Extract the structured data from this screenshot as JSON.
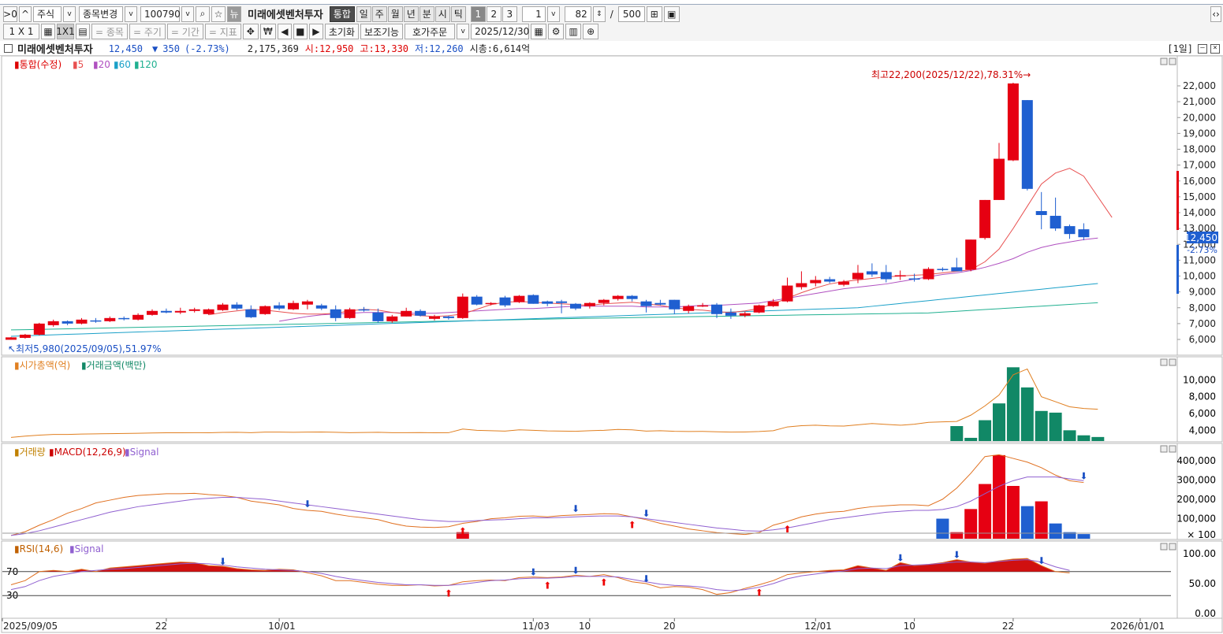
{
  "toolbar1": {
    "market": "주식",
    "change_label": "종목변경",
    "code": "100790",
    "news": "뉴",
    "stock_name": "미래에셋벤처투자",
    "combine": "통합",
    "periods": [
      "일",
      "주",
      "월",
      "년",
      "분",
      "시",
      "틱"
    ],
    "pages": [
      "1",
      "2",
      "3"
    ],
    "unit": "1",
    "count": "82",
    "slash": "/",
    "total": "500"
  },
  "toolbar2": {
    "layouts": [
      "1 X 1",
      "1X1"
    ],
    "grey": [
      "= 종목",
      "= 주기",
      "= 기간",
      "= 지표"
    ],
    "reset": "초기화",
    "aux": "보조기능",
    "order": "호가주문",
    "date": "2025/12/30"
  },
  "info": {
    "name": "미래에셋벤처투자",
    "price": "12,450",
    "change_arrow": "▼",
    "change": "350",
    "change_pct": "(-2.73%)",
    "volume": "2,175,369",
    "open": "시:12,950",
    "high": "고:13,330",
    "low": "저:12,260",
    "mktcap": "시총:6,614억",
    "period_tag": "[1일]"
  },
  "colors": {
    "up": "#e60012",
    "down": "#1f5fd0",
    "ma5": "#e85050",
    "ma20": "#b050c0",
    "ma60": "#1aa0c8",
    "ma120": "#20b090",
    "mktcap": "#e07f20",
    "amount": "#118866",
    "macd": "#e07020",
    "signal": "#9060d0"
  },
  "chart_data": [
    {
      "type": "candlestick",
      "title": "통합(수정)",
      "legend": [
        "5",
        "20",
        "60",
        "120"
      ],
      "ylim": [
        5000,
        23000
      ],
      "yticks": [
        "22,000",
        "21,000",
        "20,000",
        "19,000",
        "18,000",
        "17,000",
        "16,000",
        "15,000",
        "14,000",
        "13,000",
        "12,000",
        "11,000",
        "10,000",
        "9,000",
        "8,000",
        "7,000",
        "6,000"
      ],
      "high_annotation": "최고22,200(2025/12/22),78.31%",
      "low_annotation": "최저5,980(2025/09/05),51.97%",
      "last_price_label": "12,450",
      "last_pct_label": "-2.73%",
      "ohlc": [
        [
          5980,
          6150,
          5980,
          6130
        ],
        [
          6100,
          6350,
          6050,
          6300
        ],
        [
          6300,
          7050,
          6250,
          7000
        ],
        [
          6900,
          7250,
          6800,
          7150
        ],
        [
          7150,
          7200,
          6900,
          7000
        ],
        [
          7000,
          7350,
          6950,
          7250
        ],
        [
          7200,
          7350,
          7050,
          7150
        ],
        [
          7150,
          7450,
          7100,
          7350
        ],
        [
          7350,
          7450,
          7200,
          7300
        ],
        [
          7250,
          7650,
          7200,
          7550
        ],
        [
          7550,
          7900,
          7500,
          7800
        ],
        [
          7800,
          7950,
          7650,
          7700
        ],
        [
          7700,
          8000,
          7600,
          7800
        ],
        [
          7800,
          8000,
          7700,
          7900
        ],
        [
          7600,
          7950,
          7550,
          7900
        ],
        [
          7850,
          8300,
          7800,
          8200
        ],
        [
          8200,
          8350,
          7850,
          7950
        ],
        [
          7900,
          8150,
          7350,
          7400
        ],
        [
          7600,
          8150,
          7550,
          8100
        ],
        [
          8150,
          8350,
          7850,
          7950
        ],
        [
          7900,
          8450,
          7850,
          8300
        ],
        [
          8200,
          8500,
          7900,
          8400
        ],
        [
          8150,
          8250,
          7850,
          7950
        ],
        [
          7900,
          8150,
          7150,
          7350
        ],
        [
          7350,
          8000,
          7300,
          7900
        ],
        [
          7900,
          8050,
          7750,
          7850
        ],
        [
          7700,
          7950,
          7050,
          7150
        ],
        [
          7150,
          7550,
          7050,
          7450
        ],
        [
          7450,
          8000,
          7450,
          7800
        ],
        [
          7800,
          7900,
          7450,
          7500
        ],
        [
          7300,
          7550,
          7200,
          7450
        ],
        [
          7450,
          7500,
          7250,
          7350
        ],
        [
          7350,
          8900,
          7300,
          8700
        ],
        [
          8700,
          8800,
          8150,
          8200
        ],
        [
          8300,
          8350,
          8150,
          8300
        ],
        [
          8650,
          8750,
          8050,
          8150
        ],
        [
          8350,
          8800,
          8300,
          8750
        ],
        [
          8800,
          8850,
          8250,
          8250
        ],
        [
          8400,
          8450,
          8100,
          8250
        ],
        [
          8400,
          8500,
          7650,
          8300
        ],
        [
          8250,
          8300,
          7850,
          7950
        ],
        [
          8100,
          8350,
          7950,
          8300
        ],
        [
          8300,
          8550,
          8150,
          8500
        ],
        [
          8550,
          8800,
          8450,
          8750
        ],
        [
          8750,
          8800,
          8400,
          8550
        ],
        [
          8400,
          8500,
          7700,
          8100
        ],
        [
          8300,
          8500,
          8150,
          8200
        ],
        [
          8500,
          8500,
          7600,
          7900
        ],
        [
          7800,
          8200,
          7650,
          8100
        ],
        [
          8150,
          8300,
          8050,
          8150
        ],
        [
          8200,
          8300,
          7350,
          7600
        ],
        [
          7700,
          7950,
          7300,
          7500
        ],
        [
          7500,
          7750,
          7400,
          7650
        ],
        [
          7700,
          8200,
          7650,
          8150
        ],
        [
          8100,
          8550,
          8050,
          8400
        ],
        [
          8400,
          9900,
          8350,
          9400
        ],
        [
          9300,
          10300,
          9150,
          9550
        ],
        [
          9550,
          10000,
          9350,
          9750
        ],
        [
          9800,
          9950,
          9550,
          9650
        ],
        [
          9450,
          9750,
          9350,
          9650
        ],
        [
          9800,
          10700,
          9550,
          10200
        ],
        [
          10300,
          10800,
          9950,
          10100
        ],
        [
          10250,
          10700,
          9600,
          9800
        ],
        [
          10000,
          10350,
          9750,
          10050
        ],
        [
          9850,
          10150,
          9650,
          9800
        ],
        [
          9800,
          10550,
          9750,
          10450
        ],
        [
          10450,
          10550,
          10300,
          10400
        ],
        [
          10550,
          11150,
          10300,
          10300
        ],
        [
          10400,
          12300,
          10300,
          12300
        ],
        [
          12400,
          14800,
          12300,
          14800
        ],
        [
          14800,
          18400,
          14800,
          17400
        ],
        [
          17300,
          22200,
          17250,
          22150
        ],
        [
          21100,
          21100,
          15400,
          15500
        ],
        [
          14100,
          15300,
          12950,
          13850
        ],
        [
          13800,
          14950,
          12850,
          13000
        ],
        [
          13150,
          13250,
          12350,
          12650
        ],
        [
          12950,
          13330,
          12260,
          12450
        ]
      ],
      "ma5_start": 14,
      "ma5": [
        7550,
        7700,
        7800,
        7900,
        7850,
        7750,
        7650,
        7600,
        7600,
        7650,
        7800,
        7900,
        7850,
        7700,
        7600,
        7500,
        7450,
        7500,
        7600,
        7900,
        8200,
        8350,
        8400,
        8350,
        8300,
        8250,
        8200,
        8150,
        8250,
        8300,
        8350,
        8250,
        8150,
        8000,
        7900,
        7850,
        7750,
        7700,
        7800,
        7950,
        8250,
        8600,
        8950,
        9250,
        9500,
        9650,
        9750,
        9850,
        9950,
        10000,
        10050,
        10100,
        10200,
        10300,
        10400,
        10900,
        11700,
        13000,
        14400,
        15800,
        16500,
        16800,
        16300,
        15000,
        13700
      ],
      "ma20_start": 19,
      "ma20": [
        7150,
        7300,
        7450,
        7550,
        7600,
        7650,
        7700,
        7700,
        7700,
        7650,
        7650,
        7650,
        7700,
        7750,
        7800,
        7850,
        7900,
        7950,
        7950,
        8000,
        8050,
        8100,
        8100,
        8100,
        8100,
        8100,
        8050,
        8050,
        8050,
        8100,
        8150,
        8150,
        8200,
        8250,
        8300,
        8450,
        8600,
        8750,
        8900,
        9050,
        9200,
        9300,
        9400,
        9500,
        9650,
        9800,
        9950,
        10100,
        10200,
        10350,
        10550,
        10800,
        11100,
        11500,
        11800,
        12000,
        12150,
        12300,
        12400
      ]
    },
    {
      "type": "bar",
      "title": "시가총액(억)",
      "series2": "거래금액(백만)",
      "ylim": [
        3000,
        12000
      ],
      "yticks": [
        "10,000",
        "8,000",
        "6,000",
        "4,000"
      ],
      "bars_note": "거래금액 bars (index:value)",
      "bar_values": {
        "55": 300,
        "58": 200,
        "63": 200,
        "66": 500,
        "67": 4500,
        "68": 3100,
        "69": 5200,
        "70": 7200,
        "71": 11500,
        "72": 9100,
        "73": 6300,
        "74": 6100,
        "75": 4000,
        "76": 3400,
        "77": 3200
      },
      "mktcap_line": [
        3150,
        3300,
        3420,
        3500,
        3500,
        3550,
        3580,
        3600,
        3620,
        3650,
        3680,
        3700,
        3700,
        3720,
        3700,
        3750,
        3760,
        3720,
        3780,
        3790,
        3760,
        3780,
        3800,
        3760,
        3720,
        3740,
        3760,
        3720,
        3720,
        3730,
        3700,
        3710,
        4150,
        4000,
        3950,
        3900,
        4050,
        4000,
        3920,
        3900,
        3880,
        3950,
        4000,
        4100,
        4050,
        3900,
        3950,
        3880,
        3850,
        3870,
        3820,
        3780,
        3800,
        3850,
        3950,
        4400,
        4550,
        4600,
        4520,
        4500,
        4650,
        4800,
        4700,
        4600,
        4720,
        4950,
        5000,
        5050,
        5800,
        6900,
        8200,
        10600,
        11300,
        8000,
        7400,
        6800,
        6600,
        6500
      ]
    },
    {
      "type": "bar",
      "title": "거래량",
      "series2": "MACD(12,26,9)",
      "series3": "Signal",
      "ylim": [
        0,
        450000
      ],
      "yticks": [
        "400,000",
        "300,000",
        "200,000",
        "100,000",
        "× 100"
      ],
      "volume_up": {
        "32": 30000,
        "67": 30000,
        "68": 150000,
        "69": 280000,
        "70": 430000,
        "71": 270000,
        "73": 190000
      },
      "volume_down": {
        "66": 100000,
        "72": 165000,
        "74": 75000,
        "75": 30000,
        "76": 20000
      },
      "macd_line": [
        5,
        25,
        60,
        90,
        125,
        150,
        180,
        195,
        210,
        220,
        225,
        230,
        230,
        232,
        225,
        220,
        210,
        190,
        180,
        170,
        150,
        140,
        135,
        120,
        108,
        100,
        90,
        70,
        55,
        50,
        48,
        52,
        70,
        80,
        95,
        100,
        108,
        110,
        105,
        112,
        115,
        118,
        122,
        120,
        105,
        90,
        70,
        55,
        40,
        30,
        20,
        15,
        10,
        20,
        60,
        80,
        105,
        120,
        130,
        135,
        150,
        160,
        165,
        170,
        170,
        165,
        200,
        260,
        340,
        430,
        440,
        420,
        400,
        370,
        330,
        300,
        290
      ],
      "signal_line": [
        5,
        15,
        30,
        50,
        70,
        90,
        110,
        130,
        145,
        160,
        170,
        180,
        190,
        200,
        205,
        210,
        210,
        205,
        200,
        190,
        180,
        170,
        160,
        150,
        140,
        130,
        120,
        110,
        100,
        90,
        85,
        80,
        80,
        85,
        88,
        90,
        95,
        100,
        100,
        102,
        105,
        108,
        110,
        110,
        105,
        95,
        85,
        75,
        65,
        55,
        45,
        38,
        30,
        28,
        35,
        45,
        60,
        75,
        90,
        100,
        110,
        120,
        130,
        135,
        140,
        140,
        145,
        160,
        190,
        230,
        270,
        300,
        320,
        320,
        320,
        310,
        300
      ]
    },
    {
      "type": "area",
      "title": "RSI(14,6)",
      "series2": "Signal",
      "ylim": [
        0,
        110
      ],
      "yticks": [
        "100.00",
        "70",
        "50.00",
        "30",
        "0.00"
      ],
      "rsi": [
        48,
        55,
        70,
        72,
        70,
        74,
        70,
        76,
        78,
        80,
        82,
        84,
        86,
        85,
        80,
        79,
        75,
        73,
        72,
        74,
        73,
        68,
        63,
        55,
        55,
        52,
        49,
        47,
        47,
        48,
        46,
        47,
        53,
        55,
        56,
        55,
        60,
        61,
        60,
        61,
        64,
        62,
        65,
        60,
        53,
        50,
        43,
        45,
        44,
        40,
        32,
        35,
        42,
        48,
        55,
        65,
        68,
        70,
        72,
        73,
        80,
        76,
        72,
        85,
        80,
        82,
        85,
        90,
        86,
        84,
        88,
        91,
        92,
        80,
        70,
        68
      ],
      "rsi_signal": [
        40,
        45,
        55,
        62,
        66,
        70,
        72,
        74,
        75,
        77,
        79,
        81,
        83,
        84,
        83,
        81,
        78,
        76,
        74,
        73,
        72,
        70,
        67,
        62,
        58,
        55,
        52,
        50,
        48,
        48,
        47,
        47,
        49,
        52,
        55,
        56,
        58,
        59,
        59,
        60,
        62,
        62,
        62,
        61,
        57,
        53,
        49,
        47,
        46,
        44,
        40,
        38,
        40,
        44,
        50,
        58,
        63,
        66,
        69,
        71,
        75,
        76,
        75,
        80,
        81,
        82,
        84,
        86,
        86,
        85,
        87,
        89,
        90,
        86,
        78,
        72
      ]
    },
    {
      "type": "axis",
      "xticks": [
        "2025/09/05",
        "22",
        "10/01",
        "11/03",
        "10",
        "20",
        "12/01",
        "10",
        "22",
        "2026/01/01"
      ]
    }
  ]
}
